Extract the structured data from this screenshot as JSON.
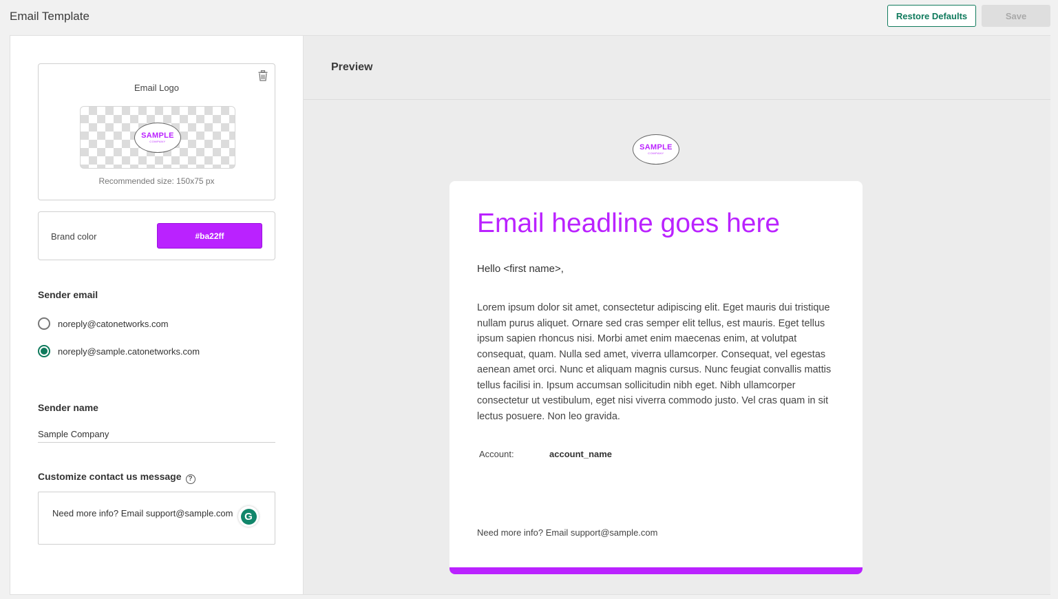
{
  "header": {
    "title": "Email Template",
    "restore_label": "Restore Defaults",
    "save_label": "Save"
  },
  "settings": {
    "logo": {
      "label": "Email Logo",
      "logo_text": "SAMPLE",
      "logo_subtext": "COMPANY",
      "recommended_size": "Recommended size: 150x75 px"
    },
    "brand": {
      "label": "Brand color",
      "value": "#ba22ff"
    },
    "sender_email": {
      "title": "Sender email",
      "options": [
        {
          "label": "noreply@catonetworks.com",
          "selected": false
        },
        {
          "label": "noreply@sample.catonetworks.com",
          "selected": true
        }
      ]
    },
    "sender_name": {
      "title": "Sender name",
      "value": "Sample Company"
    },
    "contact": {
      "title": "Customize contact us message",
      "message": "Need more info? Email support@sample.com",
      "help_glyph": "?",
      "grammarly_glyph": "G"
    }
  },
  "preview": {
    "title": "Preview",
    "logo_text": "SAMPLE",
    "logo_subtext": "COMPANY",
    "headline": "Email headline goes here",
    "greeting": "Hello <first name>,",
    "body": "Lorem ipsum dolor sit amet, consectetur adipiscing elit. Eget mauris dui tristique nullam purus aliquet. Ornare sed cras semper elit tellus, est mauris. Eget tellus ipsum sapien rhoncus nisi. Morbi amet enim maecenas enim, at volutpat consequat, quam. Nulla sed amet, viverra ullamcorper. Consequat, vel egestas aenean amet orci. Nunc et aliquam magnis cursus. Nunc feugiat convallis mattis tellus facilisi in. Ipsum accumsan sollicitudin nibh eget. Nibh ullamcorper consectetur ut vestibulum, eget nisi viverra commodo justo. Vel cras quam in sit lectus posuere. Non leo gravida.",
    "account_label": "Account:",
    "account_value": "account_name",
    "footer": "Need more info? Email support@sample.com"
  },
  "colors": {
    "brand": "#ba22ff",
    "accent": "#0f7a5c"
  }
}
